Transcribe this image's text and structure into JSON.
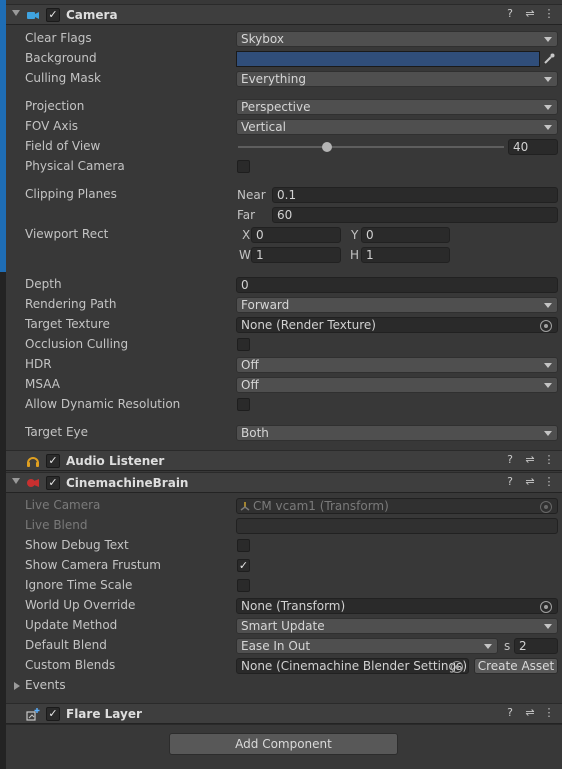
{
  "camera": {
    "title": "Camera",
    "clear_flags": {
      "label": "Clear Flags",
      "value": "Skybox"
    },
    "background": {
      "label": "Background",
      "color": "#304e7a"
    },
    "culling_mask": {
      "label": "Culling Mask",
      "value": "Everything"
    },
    "projection": {
      "label": "Projection",
      "value": "Perspective"
    },
    "fov_axis": {
      "label": "FOV Axis",
      "value": "Vertical"
    },
    "field_of_view": {
      "label": "Field of View",
      "value": "40",
      "slider_fraction": 0.335
    },
    "physical_camera": {
      "label": "Physical Camera",
      "checked": false
    },
    "clipping_planes": {
      "label": "Clipping Planes",
      "near_label": "Near",
      "near": "0.1",
      "far_label": "Far",
      "far": "60"
    },
    "viewport_rect": {
      "label": "Viewport Rect",
      "x_label": "X",
      "x": "0",
      "y_label": "Y",
      "y": "0",
      "w_label": "W",
      "w": "1",
      "h_label": "H",
      "h": "1"
    },
    "depth": {
      "label": "Depth",
      "value": "0"
    },
    "rendering_path": {
      "label": "Rendering Path",
      "value": "Forward"
    },
    "target_texture": {
      "label": "Target Texture",
      "value": "None (Render Texture)"
    },
    "occlusion_culling": {
      "label": "Occlusion Culling",
      "checked": false
    },
    "hdr": {
      "label": "HDR",
      "value": "Off"
    },
    "msaa": {
      "label": "MSAA",
      "value": "Off"
    },
    "allow_dynamic_resolution": {
      "label": "Allow Dynamic Resolution",
      "checked": false
    },
    "target_eye": {
      "label": "Target Eye",
      "value": "Both"
    }
  },
  "audio_listener": {
    "title": "Audio Listener"
  },
  "cinemachine_brain": {
    "title": "CinemachineBrain",
    "live_camera": {
      "label": "Live Camera",
      "value": "CM vcam1 (Transform)"
    },
    "live_blend": {
      "label": "Live Blend",
      "value": ""
    },
    "show_debug_text": {
      "label": "Show Debug Text",
      "checked": false
    },
    "show_camera_frustum": {
      "label": "Show Camera Frustum",
      "checked": true
    },
    "ignore_time_scale": {
      "label": "Ignore Time Scale",
      "checked": false
    },
    "world_up_override": {
      "label": "World Up Override",
      "value": "None (Transform)"
    },
    "update_method": {
      "label": "Update Method",
      "value": "Smart Update"
    },
    "default_blend": {
      "label": "Default Blend",
      "value": "Ease In Out",
      "s_label": "s",
      "seconds": "2"
    },
    "custom_blends": {
      "label": "Custom Blends",
      "value": "None (Cinemachine Blender Settings)",
      "button": "Create Asset"
    },
    "events": {
      "label": "Events"
    }
  },
  "flare_layer": {
    "title": "Flare Layer"
  },
  "add_component": {
    "label": "Add Component"
  },
  "header_icons": {
    "help": "?",
    "presets": "⇌",
    "menu": "⋮",
    "check": "✓"
  },
  "colors": {
    "accent_blue": "#1e6db5",
    "background": "#383838",
    "header": "#3e3e3e"
  }
}
